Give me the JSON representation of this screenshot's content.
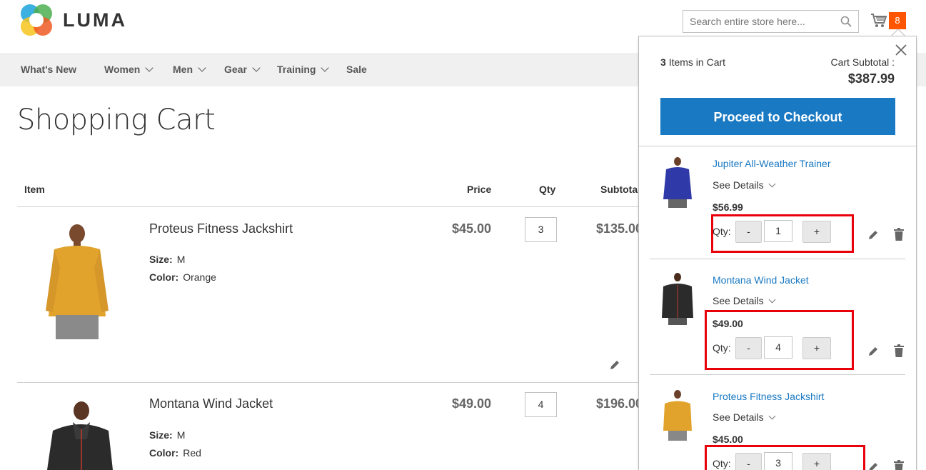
{
  "brand": {
    "name": "LUMA"
  },
  "search": {
    "placeholder": "Search entire store here..."
  },
  "cart_badge": {
    "count": "8"
  },
  "nav": {
    "items": [
      {
        "label": "What's New",
        "has_dropdown": false
      },
      {
        "label": "Women",
        "has_dropdown": true
      },
      {
        "label": "Men",
        "has_dropdown": true
      },
      {
        "label": "Gear",
        "has_dropdown": true
      },
      {
        "label": "Training",
        "has_dropdown": true
      },
      {
        "label": "Sale",
        "has_dropdown": false
      }
    ]
  },
  "page": {
    "title": "Shopping Cart"
  },
  "cart_table": {
    "headers": {
      "item": "Item",
      "price": "Price",
      "qty": "Qty",
      "subtotal": "Subtota"
    },
    "rows": [
      {
        "name": "Proteus Fitness Jackshirt",
        "options": [
          {
            "label": "Size:",
            "value": "M"
          },
          {
            "label": "Color:",
            "value": "Orange"
          }
        ],
        "price": "$45.00",
        "qty": "3",
        "subtotal": "$135.00",
        "colors": {
          "shirt": "#e1a32b",
          "pants": "#8a8a8a"
        }
      },
      {
        "name": "Montana Wind Jacket",
        "options": [
          {
            "label": "Size:",
            "value": "M"
          },
          {
            "label": "Color:",
            "value": "Red"
          }
        ],
        "price": "$49.00",
        "qty": "4",
        "subtotal": "$196.00",
        "colors": {
          "shirt": "#2b2b2b",
          "pants": "#444"
        }
      }
    ]
  },
  "minicart": {
    "count_num": "3",
    "count_text": "Items in Cart",
    "subtotal_label": "Cart Subtotal :",
    "subtotal_value": "$387.99",
    "checkout_label": "Proceed to Checkout",
    "items": [
      {
        "name": "Jupiter All-Weather Trainer",
        "details": "See Details",
        "price": "$56.99",
        "qty_label": "Qty:",
        "qty": "1",
        "minus": "-",
        "plus": "+",
        "colors": {
          "shirt": "#2f3aa8",
          "pants": "#666"
        }
      },
      {
        "name": "Montana Wind Jacket",
        "details": "See Details",
        "price": "$49.00",
        "qty_label": "Qty:",
        "qty": "4",
        "minus": "-",
        "plus": "+",
        "colors": {
          "shirt": "#2b2b2b",
          "pants": "#555"
        }
      },
      {
        "name": "Proteus Fitness Jackshirt",
        "details": "See Details",
        "price": "$45.00",
        "qty_label": "Qty:",
        "qty": "3",
        "minus": "-",
        "plus": "+",
        "colors": {
          "shirt": "#e1a32b",
          "pants": "#888"
        }
      }
    ]
  },
  "colors": {
    "accent": "#1979c3",
    "badge": "#ff5501",
    "highlight": "#e8000b",
    "nav_bg": "#f0f0f0"
  }
}
